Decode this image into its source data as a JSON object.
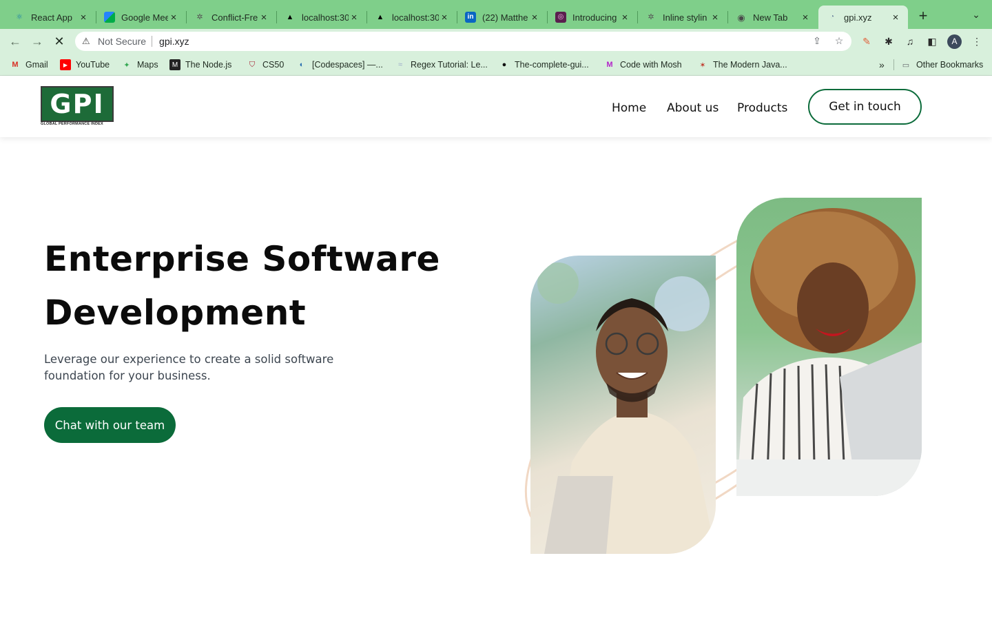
{
  "browser": {
    "tabs": [
      {
        "title": "React App",
        "icon": "react-icon"
      },
      {
        "title": "Google Mee",
        "icon": "google-meet-icon"
      },
      {
        "title": "Conflict-Fre",
        "icon": "openai-icon"
      },
      {
        "title": "localhost:30",
        "icon": "vercel-triangle-icon"
      },
      {
        "title": "localhost:30",
        "icon": "vercel-triangle-icon"
      },
      {
        "title": "(22) Matthe",
        "icon": "linkedin-icon"
      },
      {
        "title": "Introducing",
        "icon": "app-icon"
      },
      {
        "title": "Inline stylin",
        "icon": "openai-icon"
      },
      {
        "title": "New Tab",
        "icon": "chrome-icon"
      },
      {
        "title": "gpi.xyz",
        "icon": "site-icon",
        "active": true
      }
    ],
    "security_label": "Not Secure",
    "url": "gpi.xyz",
    "profile_initial": "A",
    "bookmarks": [
      {
        "label": "Gmail",
        "icon": "gmail-icon"
      },
      {
        "label": "YouTube",
        "icon": "youtube-icon"
      },
      {
        "label": "Maps",
        "icon": "maps-icon"
      },
      {
        "label": "The Node.js",
        "icon": "node-icon"
      },
      {
        "label": "CS50",
        "icon": "harvard-icon"
      },
      {
        "label": "[Codespaces] —...",
        "icon": "codespaces-icon"
      },
      {
        "label": "Regex Tutorial: Le...",
        "icon": "regex-icon"
      },
      {
        "label": "The-complete-gui...",
        "icon": "github-icon"
      },
      {
        "label": "Code with Mosh",
        "icon": "mosh-icon"
      },
      {
        "label": "The Modern Java...",
        "icon": "javascript-info-icon"
      }
    ],
    "overflow_label": "»",
    "other_bookmarks": "Other Bookmarks"
  },
  "site": {
    "logo_letters": "GPI",
    "logo_subtitle": "GLOBAL PERFORMANCE INDEX",
    "nav": [
      "Home",
      "About us",
      "Products"
    ],
    "cta_outline": "Get in touch",
    "hero": {
      "title_line1": "Enterprise Software",
      "title_line2": "Development",
      "subtitle": "Leverage our experience to create a solid software foundation for your business.",
      "cta": "Chat with our team"
    },
    "colors": {
      "brand_green": "#0b6b3a",
      "ring_color": "#f1d8c4",
      "browser_green": "#7fcf8a"
    }
  }
}
